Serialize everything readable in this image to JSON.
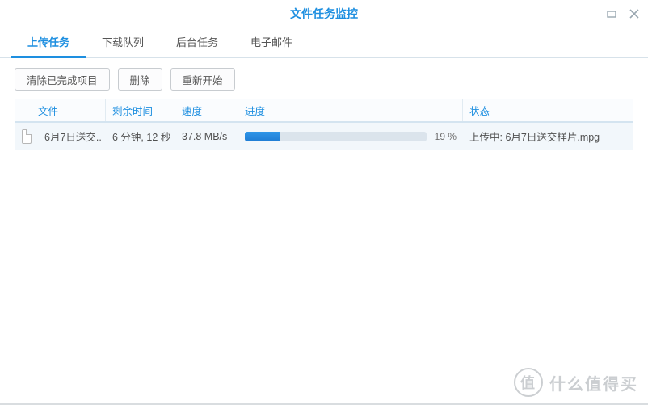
{
  "window": {
    "title": "文件任务监控"
  },
  "tabs": {
    "items": [
      {
        "label": "上传任务",
        "active": true
      },
      {
        "label": "下载队列",
        "active": false
      },
      {
        "label": "后台任务",
        "active": false
      },
      {
        "label": "电子邮件",
        "active": false
      }
    ]
  },
  "toolbar": {
    "clear_completed": "清除已完成项目",
    "delete": "删除",
    "restart": "重新开始"
  },
  "columns": {
    "file": "文件",
    "time_remaining": "剩余时间",
    "speed": "速度",
    "progress": "进度",
    "status": "状态"
  },
  "rows": [
    {
      "file": "6月7日送交..",
      "time_remaining": "6 分钟, 12 秒",
      "speed": "37.8 MB/s",
      "progress_pct": 19,
      "progress_label": "19 %",
      "status": "上传中: 6月7日送交样片.mpg"
    }
  ],
  "watermark": {
    "badge": "值",
    "text": "什么值得买"
  }
}
